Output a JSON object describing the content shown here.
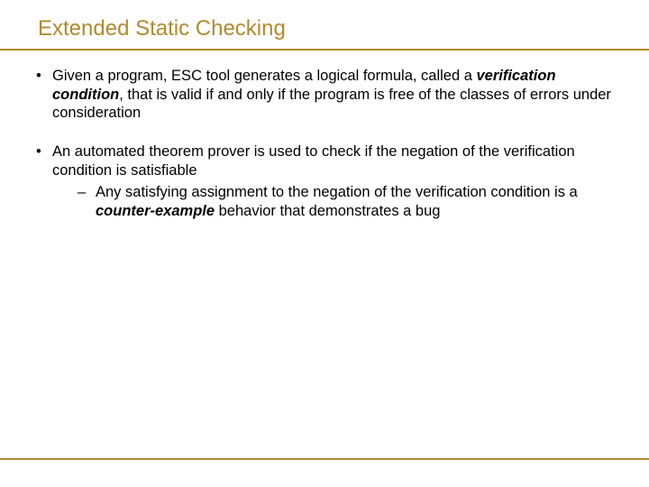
{
  "title": "Extended Static Checking",
  "bullets": [
    {
      "pre": "Given a program, ESC tool generates a logical formula, called a ",
      "em": "verification condition",
      "post": ", that is valid if and only if the program is free of the classes of errors under consideration"
    },
    {
      "pre": "An automated theorem prover is used to check if the negation of the verification condition is satisfiable",
      "sub": {
        "pre": "Any satisfying assignment to the negation of the verification condition is a ",
        "em": "counter-example",
        "post": " behavior that demonstrates a bug"
      }
    }
  ],
  "markers": {
    "bullet": "•",
    "dash": "–"
  }
}
